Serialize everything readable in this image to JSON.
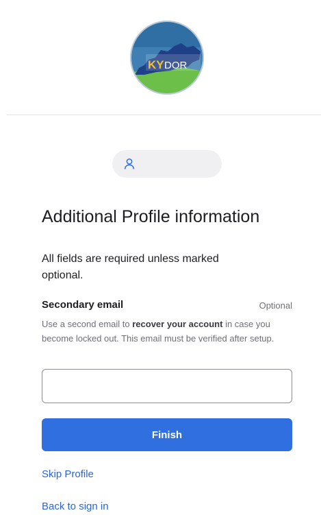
{
  "logo": {
    "text_ky": "KY",
    "text_dor": "DOR",
    "colors": {
      "sky": "#2f6fa3",
      "ring": "#b9c9d6",
      "state": "#1f3f86",
      "grass": "#6cc04a"
    }
  },
  "user": {
    "icon": "user-icon",
    "name": ""
  },
  "heading": {
    "title": "Additional Profile information",
    "subtitle": "All fields are required unless marked optional."
  },
  "secondary_email": {
    "label": "Secondary email",
    "optional_label": "Optional",
    "help_prefix": "Use a second email to ",
    "help_bold": "recover your account",
    "help_suffix": " in case you become locked out. This email must be verified after setup.",
    "value": "",
    "placeholder": ""
  },
  "actions": {
    "finish_label": "Finish",
    "skip_label": "Skip Profile",
    "back_label": "Back to sign in"
  },
  "colors": {
    "primary": "#2f6fe0",
    "link": "#2866d8"
  }
}
